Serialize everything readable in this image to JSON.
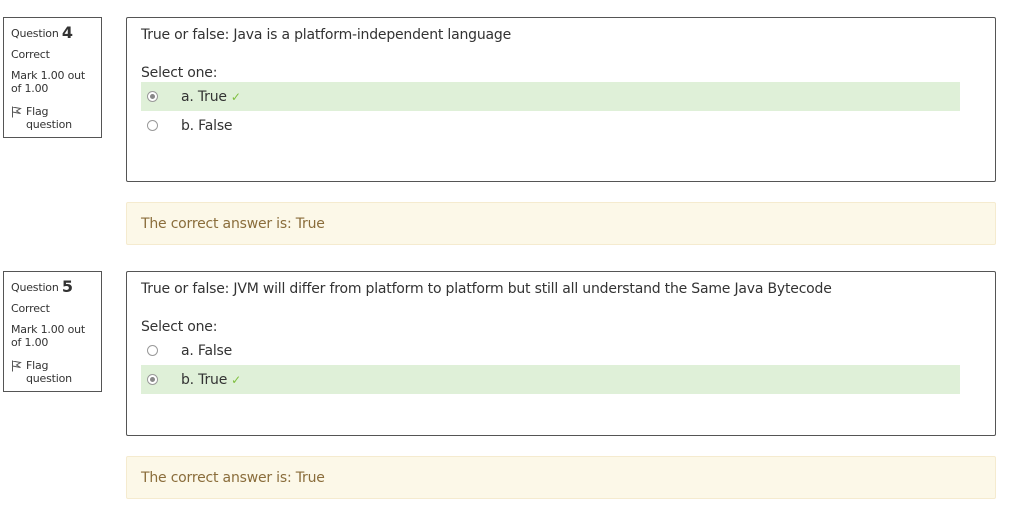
{
  "questions": [
    {
      "label": "Question",
      "number": "4",
      "state": "Correct",
      "grade": "Mark 1.00 out of 1.00",
      "flag_label": "Flag question",
      "text": "True or false: Java is a platform-independent language",
      "prompt": "Select one:",
      "options": [
        {
          "label": "a. True",
          "checked": true,
          "correct": true
        },
        {
          "label": "b. False",
          "checked": false,
          "correct": false
        }
      ],
      "feedback": "The correct answer is: True"
    },
    {
      "label": "Question",
      "number": "5",
      "state": "Correct",
      "grade": "Mark 1.00 out of 1.00",
      "flag_label": "Flag question",
      "text": "True or false: JVM will differ from platform to platform but still all understand the Same Java Bytecode",
      "prompt": "Select one:",
      "options": [
        {
          "label": "a. False",
          "checked": false,
          "correct": false
        },
        {
          "label": "b. True",
          "checked": true,
          "correct": true
        }
      ],
      "feedback": "The correct answer is: True"
    }
  ],
  "icons": {
    "flag": "flag-icon",
    "correct": "check-icon"
  },
  "colors": {
    "correct_bg": "#dff0d8",
    "feedback_bg": "#fcf8e8",
    "feedback_text": "#8a6d3b",
    "tick": "#7fbf3f"
  }
}
